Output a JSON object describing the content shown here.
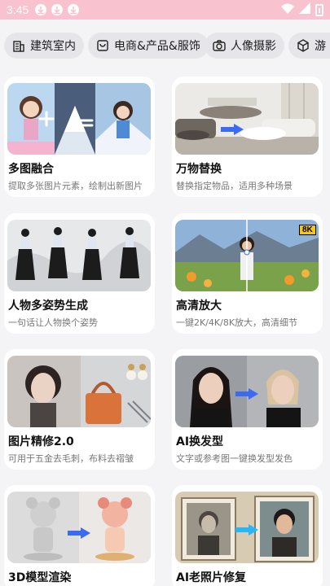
{
  "status": {
    "time": "3:45"
  },
  "categories": [
    {
      "label": "建筑室内",
      "icon": "building-icon"
    },
    {
      "label": "电商&产品&服饰",
      "icon": "shop-icon"
    },
    {
      "label": "人像摄影",
      "icon": "camera-icon"
    },
    {
      "label": "游",
      "icon": "cube-icon"
    }
  ],
  "cards": [
    {
      "title": "多图融合",
      "desc": "提取多张图片元素，绘制出新图片"
    },
    {
      "title": "万物替换",
      "desc": "替换指定物品，适用多种场景"
    },
    {
      "title": "人物多姿势生成",
      "desc": "一句话让人物换个姿势"
    },
    {
      "title": "高清放大",
      "desc": "一键2K/4K/8K放大，高清细节"
    },
    {
      "title": "图片精修2.0",
      "desc": "可用于五金去毛刺，布料去褶皱"
    },
    {
      "title": "AI换发型",
      "desc": "文字或参考图一键换发型发色"
    },
    {
      "title": "3D模型渲染",
      "desc": ""
    },
    {
      "title": "AI老照片修复",
      "desc": ""
    }
  ],
  "badge": {
    "upscale": "8K"
  },
  "colors": {
    "statusBar": "#f8c3cf",
    "cardBg": "#ffffff",
    "pageBg": "#f4f4f6",
    "chipBg": "#e6e6ea",
    "arrow": "#3b6bf5"
  }
}
